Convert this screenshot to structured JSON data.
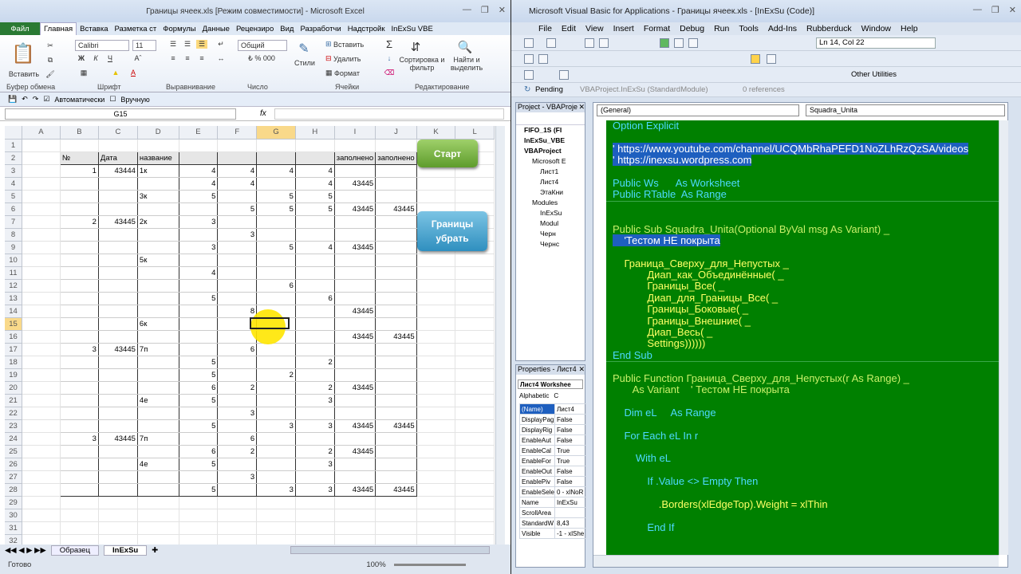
{
  "excel": {
    "title": "Границы ячеек.xls  [Режим совместимости]  -  Microsoft Excel",
    "file_tab": "Файл",
    "tabs": [
      "Главная",
      "Вставка",
      "Разметка ст",
      "Формулы",
      "Данные",
      "Рецензиро",
      "Вид",
      "Разработчи",
      "Надстройк",
      "InExSu VBE"
    ],
    "groups": [
      "Буфер обмена",
      "Шрифт",
      "Выравнивание",
      "Число",
      "Ячейки",
      "Редактирование"
    ],
    "paste_label": "Вставить",
    "font_name": "Calibri",
    "font_size": "11",
    "number_format": "Общий",
    "styles_label": "Стили",
    "cells_insert": "Вставить",
    "cells_delete": "Удалить",
    "cells_format": "Формат",
    "sort_label": "Сортировка и фильтр",
    "find_label": "Найти и выделить",
    "qat_auto": "Автоматически",
    "qat_manual": "Вручную",
    "name_box": "G15",
    "fx": "fx",
    "columns": [
      "A",
      "B",
      "C",
      "D",
      "E",
      "F",
      "G",
      "H",
      "I",
      "J",
      "K",
      "L"
    ],
    "rows": [
      [
        "",
        "",
        "",
        "",
        "",
        "",
        "",
        "",
        "",
        "",
        "",
        ""
      ],
      [
        "",
        "№",
        "Дата",
        "название",
        "",
        "",
        "",
        "",
        "заполнено",
        "заполнено",
        "",
        ""
      ],
      [
        "",
        "1",
        "43444",
        "1к",
        "4",
        "4",
        "4",
        "4",
        "",
        "",
        "",
        ""
      ],
      [
        "",
        "",
        "",
        "",
        "4",
        "4",
        "",
        "4",
        "43445",
        "",
        "",
        ""
      ],
      [
        "",
        "",
        "",
        "3к",
        "5",
        "",
        "5",
        "5",
        "",
        "",
        "",
        ""
      ],
      [
        "",
        "",
        "",
        "",
        "",
        "5",
        "5",
        "5",
        "43445",
        "43445",
        "",
        ""
      ],
      [
        "",
        "2",
        "43445",
        "2к",
        "3",
        "",
        "",
        "",
        "",
        "",
        "",
        ""
      ],
      [
        "",
        "",
        "",
        "",
        "",
        "3",
        "",
        "",
        "",
        "",
        "",
        ""
      ],
      [
        "",
        "",
        "",
        "",
        "3",
        "",
        "5",
        "4",
        "43445",
        "",
        "",
        ""
      ],
      [
        "",
        "",
        "",
        "5к",
        "",
        "",
        "",
        "",
        "",
        "",
        "",
        ""
      ],
      [
        "",
        "",
        "",
        "",
        "4",
        "",
        "",
        "",
        "",
        "",
        "",
        ""
      ],
      [
        "",
        "",
        "",
        "",
        "",
        "",
        "6",
        "",
        "",
        "",
        "",
        ""
      ],
      [
        "",
        "",
        "",
        "",
        "5",
        "",
        "",
        "6",
        "",
        "",
        "",
        ""
      ],
      [
        "",
        "",
        "",
        "",
        "",
        "8",
        "",
        "",
        "43445",
        "",
        "",
        ""
      ],
      [
        "",
        "",
        "",
        "6к",
        "",
        "",
        "",
        "",
        "",
        "",
        "",
        ""
      ],
      [
        "",
        "",
        "",
        "",
        "",
        "",
        "",
        "",
        "43445",
        "43445",
        "",
        ""
      ],
      [
        "",
        "3",
        "43445",
        "7п",
        "",
        "6",
        "",
        "",
        "",
        "",
        "",
        ""
      ],
      [
        "",
        "",
        "",
        "",
        "5",
        "",
        "",
        "2",
        "",
        "",
        "",
        ""
      ],
      [
        "",
        "",
        "",
        "",
        "5",
        "",
        "2",
        "",
        "",
        "",
        "",
        ""
      ],
      [
        "",
        "",
        "",
        "",
        "6",
        "2",
        "",
        "2",
        "43445",
        "",
        "",
        ""
      ],
      [
        "",
        "",
        "",
        "4е",
        "5",
        "",
        "",
        "3",
        "",
        "",
        "",
        ""
      ],
      [
        "",
        "",
        "",
        "",
        "",
        "3",
        "",
        "",
        "",
        "",
        "",
        ""
      ],
      [
        "",
        "",
        "",
        "",
        "5",
        "",
        "3",
        "3",
        "43445",
        "43445",
        "",
        ""
      ],
      [
        "",
        "3",
        "43445",
        "7п",
        "",
        "6",
        "",
        "",
        "",
        "",
        "",
        ""
      ],
      [
        "",
        "",
        "",
        "",
        "6",
        "2",
        "",
        "2",
        "43445",
        "",
        "",
        ""
      ],
      [
        "",
        "",
        "",
        "4е",
        "5",
        "",
        "",
        "3",
        "",
        "",
        "",
        ""
      ],
      [
        "",
        "",
        "",
        "",
        "",
        "3",
        "",
        "",
        "",
        "",
        "",
        ""
      ],
      [
        "",
        "",
        "",
        "",
        "5",
        "",
        "3",
        "3",
        "43445",
        "43445",
        "",
        ""
      ],
      [
        "",
        "",
        "",
        "",
        "",
        "",
        "",
        "",
        "",
        "",
        "",
        ""
      ],
      [
        "",
        "",
        "",
        "",
        "",
        "",
        "",
        "",
        "",
        "",
        "",
        ""
      ],
      [
        "",
        "",
        "",
        "",
        "",
        "",
        "",
        "",
        "",
        "",
        "",
        ""
      ],
      [
        "",
        "",
        "",
        "",
        "",
        "",
        "",
        "",
        "",
        "",
        "",
        ""
      ]
    ],
    "start_button": "Старт",
    "borders_button": "Границы убрать",
    "sheets": [
      "Образец",
      "InExSu"
    ],
    "status": "Готово",
    "zoom": "100%"
  },
  "vba": {
    "title": "Microsoft Visual Basic for Applications - Границы ячеек.xls - [InExSu (Code)]",
    "menu": [
      "File",
      "Edit",
      "View",
      "Insert",
      "Format",
      "Debug",
      "Run",
      "Tools",
      "Add-Ins",
      "Rubberduck",
      "Window",
      "Help"
    ],
    "position": "Ln 14, Col 22",
    "other_utilities": "Other Utilities",
    "pending": "Pending",
    "pending_module": "VBAProject.InExSu (StandardModule)",
    "references": "0 references",
    "project_title": "Project - VBAProje",
    "tree": [
      "FIFO_1S (FI",
      "InExSu_VBE",
      "VBAProject",
      "Microsoft E",
      "Лист1",
      "Лист4",
      "ЭтаКни",
      "Modules",
      "InExSu",
      "Modul",
      "Черн",
      "Чернс"
    ],
    "props_title": "Properties - Лист4",
    "props_object": "Лист4 Workshee",
    "props_tabs": [
      "Alphabetic",
      "C"
    ],
    "props": [
      [
        "(Name)",
        "Лист4"
      ],
      [
        "DisplayPag",
        "False"
      ],
      [
        "DisplayRig",
        "False"
      ],
      [
        "EnableAut",
        "False"
      ],
      [
        "EnableCal",
        "True"
      ],
      [
        "EnableFor",
        "True"
      ],
      [
        "EnableOut",
        "False"
      ],
      [
        "EnablePiv",
        "False"
      ],
      [
        "EnableSele",
        "0 - xlNoR"
      ],
      [
        "Name",
        "InExSu"
      ],
      [
        "ScrollArea",
        ""
      ],
      [
        "StandardW",
        "8,43"
      ],
      [
        "Visible",
        "-1 - xlShe"
      ]
    ],
    "combo_left": "(General)",
    "combo_right": "Squadra_Unita",
    "code": [
      {
        "t": "Option Explicit",
        "c": "kw"
      },
      {
        "t": "",
        "c": ""
      },
      {
        "t": "' https://www.youtube.com/channel/UCQMbRhaPEFD1NoZLhRzQzSA/videos",
        "c": "sel"
      },
      {
        "t": "' https://inexsu.wordpress.com",
        "c": "sel"
      },
      {
        "t": "",
        "c": ""
      },
      {
        "t": "Public Ws      As Worksheet",
        "c": "kw"
      },
      {
        "t": "Public RTable  As Range",
        "c": "kw"
      },
      {
        "t": "",
        "c": "sep"
      },
      {
        "t": "",
        "c": ""
      },
      {
        "t": "Public Sub Squadra_Unita(Optional ByVal msg As Variant) _",
        "c": "mix"
      },
      {
        "t": "    'Тестом НЕ покрыта",
        "c": "sel"
      },
      {
        "t": "",
        "c": ""
      },
      {
        "t": "    Граница_Сверху_для_Непустых _",
        "c": ""
      },
      {
        "t": "            Диап_как_Объединённые( _",
        "c": ""
      },
      {
        "t": "            Границы_Все( _",
        "c": ""
      },
      {
        "t": "            Диап_для_Границы_Все( _",
        "c": ""
      },
      {
        "t": "            Границы_Боковые( _",
        "c": ""
      },
      {
        "t": "            Границы_Внешние( _",
        "c": ""
      },
      {
        "t": "            Диап_Весь( _",
        "c": ""
      },
      {
        "t": "            Settings))))))",
        "c": ""
      },
      {
        "t": "End Sub",
        "c": "kw"
      },
      {
        "t": "",
        "c": "sep"
      },
      {
        "t": "Public Function Граница_Сверху_для_Непустых(r As Range) _",
        "c": "mix"
      },
      {
        "t": "       As Variant    ' Тестом НЕ покрыта",
        "c": "mix2"
      },
      {
        "t": "",
        "c": ""
      },
      {
        "t": "    Dim eL     As Range",
        "c": "kw"
      },
      {
        "t": "",
        "c": ""
      },
      {
        "t": "    For Each eL In r",
        "c": "kw"
      },
      {
        "t": "",
        "c": ""
      },
      {
        "t": "        With eL",
        "c": "kw"
      },
      {
        "t": "",
        "c": ""
      },
      {
        "t": "            If .Value <> Empty Then",
        "c": "kw"
      },
      {
        "t": "",
        "c": ""
      },
      {
        "t": "                .Borders(xlEdgeTop).Weight = xlThin",
        "c": ""
      },
      {
        "t": "",
        "c": ""
      },
      {
        "t": "            End If",
        "c": "kw"
      }
    ]
  },
  "colors": {
    "code_bg": "#008000",
    "keyword": "#4dd9ff",
    "ident": "#ffff66",
    "selection": "#1e5fbf",
    "file_tab": "#2a7a33"
  }
}
